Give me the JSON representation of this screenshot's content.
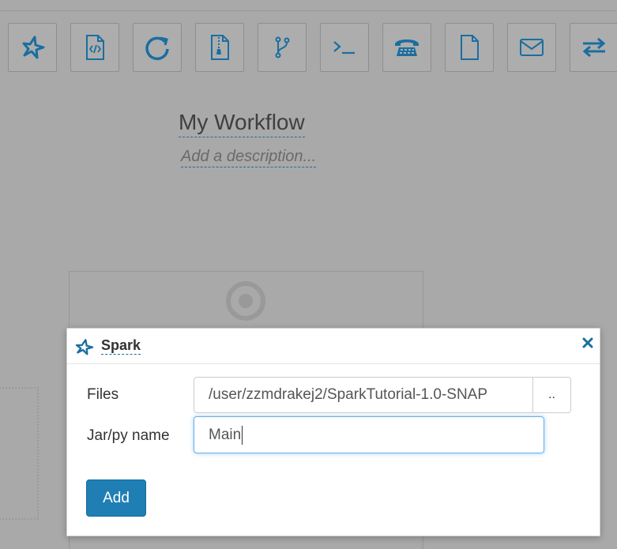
{
  "toolbar": {
    "buttons": [
      {
        "icon": "spark-icon"
      },
      {
        "icon": "code-file-icon"
      },
      {
        "icon": "refresh-circle-icon"
      },
      {
        "icon": "zip-file-icon"
      },
      {
        "icon": "git-branch-icon"
      },
      {
        "icon": "terminal-icon"
      },
      {
        "icon": "telephone-icon"
      },
      {
        "icon": "file-icon"
      },
      {
        "icon": "envelope-icon"
      },
      {
        "icon": "exchange-icon"
      }
    ],
    "icon_color": "#1a6ea0"
  },
  "workflow": {
    "title": "My Workflow",
    "description_placeholder": "Add a description..."
  },
  "modal": {
    "title": "Spark",
    "files_label": "Files",
    "files_value": "/user/zzmdrakej2/SparkTutorial-1.0-SNAP",
    "files_browse": "..",
    "jar_label": "Jar/py name",
    "jar_value": "Main",
    "add_label": "Add"
  },
  "colors": {
    "accent": "#1a6ea0",
    "primary_button": "#1f7fb5",
    "overlay": "#a9a9a9"
  }
}
